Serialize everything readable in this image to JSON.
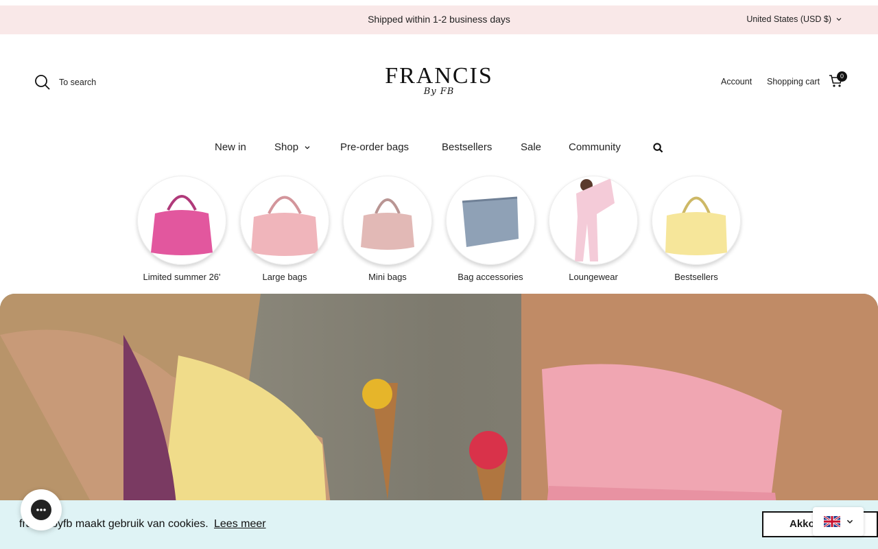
{
  "announcement": {
    "message": "Shipped within 1-2 business days",
    "currency": "United States (USD $)"
  },
  "header": {
    "search_label": "To search",
    "logo_main": "FRANCIS",
    "logo_sub": "By FB",
    "account_label": "Account",
    "cart_label": "Shopping cart",
    "cart_count": "0"
  },
  "nav": {
    "items": [
      {
        "label": "New in"
      },
      {
        "label": "Shop"
      },
      {
        "label": "Pre-order bags"
      },
      {
        "label": "Bestsellers"
      },
      {
        "label": "Sale"
      },
      {
        "label": "Community"
      }
    ]
  },
  "categories": [
    {
      "label": "Limited summer 26'",
      "color": "#e2579e"
    },
    {
      "label": "Large bags",
      "color": "#f0b5bb"
    },
    {
      "label": "Mini bags",
      "color": "#e2b9b6"
    },
    {
      "label": "Bag accessories",
      "color": "#8fa1b6"
    },
    {
      "label": "Loungewear",
      "color": "#f4cbd8"
    },
    {
      "label": "Bestsellers",
      "color": "#f6e69a"
    }
  ],
  "cookie": {
    "text": "francisbyfb maakt gebruik van cookies.",
    "more_label": "Lees meer",
    "accept_label": "Akko"
  },
  "colors": {
    "announcement_bg": "#f9e8e8",
    "cookie_bg": "#dff3f5",
    "text": "#1a1a1a"
  }
}
